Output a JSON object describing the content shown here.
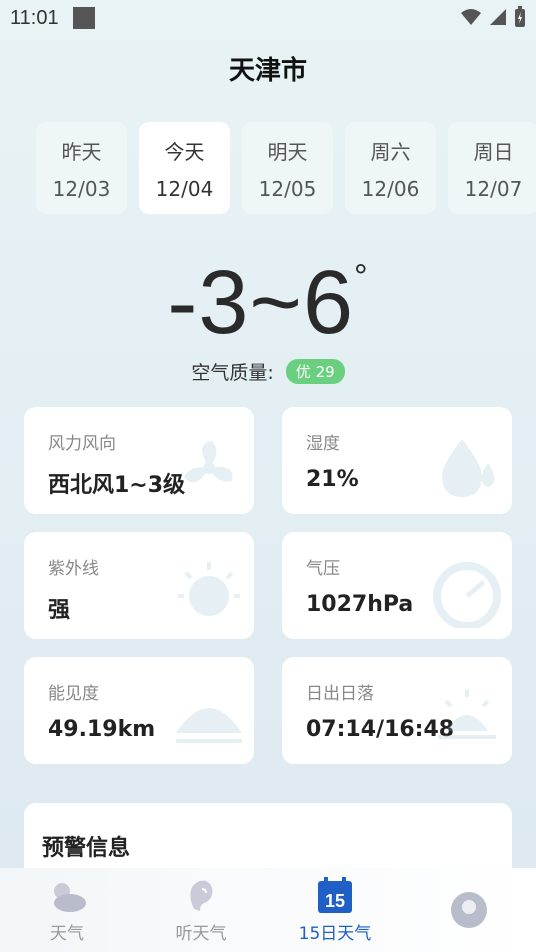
{
  "status_bar": {
    "time": "11:01"
  },
  "header": {
    "city": "天津市"
  },
  "days": [
    {
      "label": "昨天",
      "date": "12/03"
    },
    {
      "label": "今天",
      "date": "12/04"
    },
    {
      "label": "明天",
      "date": "12/05"
    },
    {
      "label": "周六",
      "date": "12/06"
    },
    {
      "label": "周日",
      "date": "12/07"
    }
  ],
  "selected_day": "今天",
  "temperature": {
    "range": "-3~6",
    "unit": "°"
  },
  "air_quality": {
    "label": "空气质量:",
    "badge": "优 29",
    "badge_color": "#6ad07f"
  },
  "cards": {
    "wind": {
      "label": "风力风向",
      "value": "西北风1~3级"
    },
    "humidity": {
      "label": "湿度",
      "value": "21%"
    },
    "uv": {
      "label": "紫外线",
      "value": "强"
    },
    "pressure": {
      "label": "气压",
      "value": "1027hPa"
    },
    "visibility": {
      "label": "能见度",
      "value": "49.19km"
    },
    "sun": {
      "label": "日出日落",
      "value": "07:14/16:48"
    }
  },
  "warning": {
    "title": "预警信息"
  },
  "nav": {
    "weather": "天气",
    "listen": "听天气",
    "fifteen_day": "15日天气",
    "fifteen_day_icon_text": "15",
    "active": "15日天气",
    "accent_color": "#1f5fc6"
  }
}
